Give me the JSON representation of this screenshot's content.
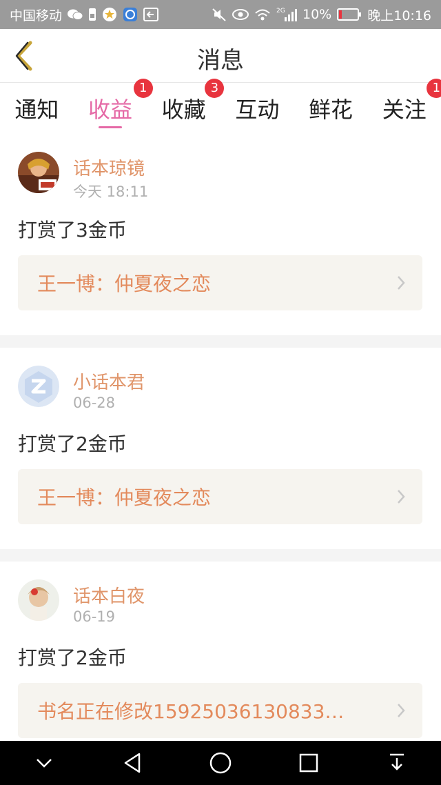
{
  "status": {
    "carrier": "中国移动",
    "signal": "2G",
    "battery": "10%",
    "time": "晚上10:16",
    "icons": [
      "wechat-icon",
      "sim-icon",
      "star-icon",
      "app-icon",
      "back-app-icon",
      "mute-icon",
      "eye-icon",
      "wifi-icon",
      "signal-icon",
      "battery-icon"
    ]
  },
  "header": {
    "title": "消息",
    "back_icon": "chevron-left-icon"
  },
  "tabs": [
    {
      "label": "通知",
      "badge": ""
    },
    {
      "label": "收益",
      "badge": "1",
      "active": true
    },
    {
      "label": "收藏",
      "badge": "3"
    },
    {
      "label": "互动",
      "badge": ""
    },
    {
      "label": "鲜花",
      "badge": ""
    },
    {
      "label": "关注",
      "badge": "1"
    }
  ],
  "messages": [
    {
      "user": "话本琼镜",
      "time": "今天 18:11",
      "text": "打赏了3金币",
      "book": "王一博：仲夏夜之恋"
    },
    {
      "user": "小话本君",
      "time": "06-28",
      "text": "打赏了2金币",
      "book": "王一博：仲夏夜之恋"
    },
    {
      "user": "话本白夜",
      "time": "06-19",
      "text": "打赏了2金币",
      "book": "书名正在修改15925036130833…"
    }
  ],
  "navbar": {
    "icons": [
      "collapse-icon",
      "back-icon",
      "home-icon",
      "recents-icon",
      "notification-pull-icon"
    ]
  },
  "colors": {
    "accent": "#e56aa6",
    "badge": "#e8343e",
    "username": "#e0956a",
    "booktitle": "#e38a5c",
    "statusbar": "#9b9b9b"
  }
}
